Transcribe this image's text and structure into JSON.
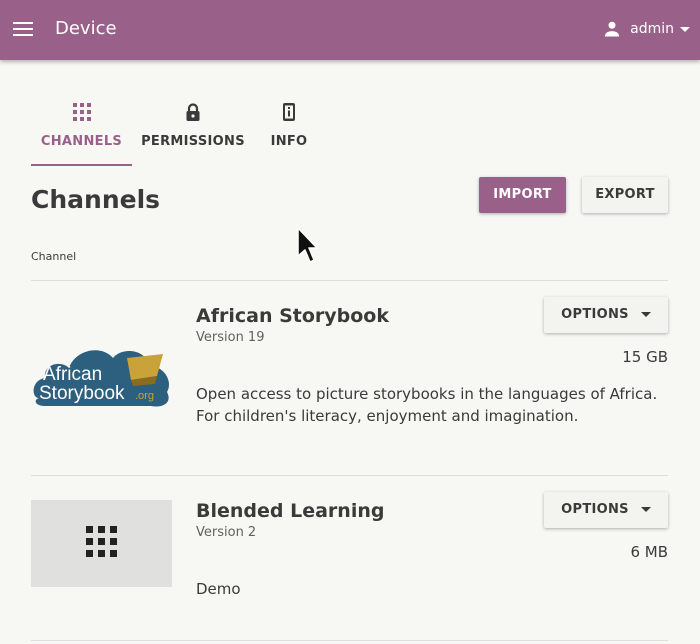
{
  "appbar": {
    "title": "Device",
    "user": "admin"
  },
  "tabs": [
    {
      "label": "CHANNELS",
      "icon": "grid-icon",
      "active": true
    },
    {
      "label": "PERMISSIONS",
      "icon": "lock-icon",
      "active": false
    },
    {
      "label": "INFO",
      "icon": "device-info-icon",
      "active": false
    }
  ],
  "main": {
    "title": "Channels",
    "import_label": "IMPORT",
    "export_label": "EXPORT",
    "column_header": "Channel"
  },
  "channels": [
    {
      "name": "African Storybook",
      "version": "Version 19",
      "size": "15 GB",
      "description": "Open access to picture storybooks in the languages of Africa. For children's literacy, enjoyment and imagination.",
      "options_label": "OPTIONS",
      "logo_text": [
        "African",
        "Storybook",
        ".org"
      ]
    },
    {
      "name": "Blended Learning",
      "version": "Version 2",
      "size": "6 MB",
      "description": "Demo",
      "options_label": "OPTIONS"
    }
  ],
  "colors": {
    "brand": "#996189",
    "background": "#f7f7f4"
  }
}
